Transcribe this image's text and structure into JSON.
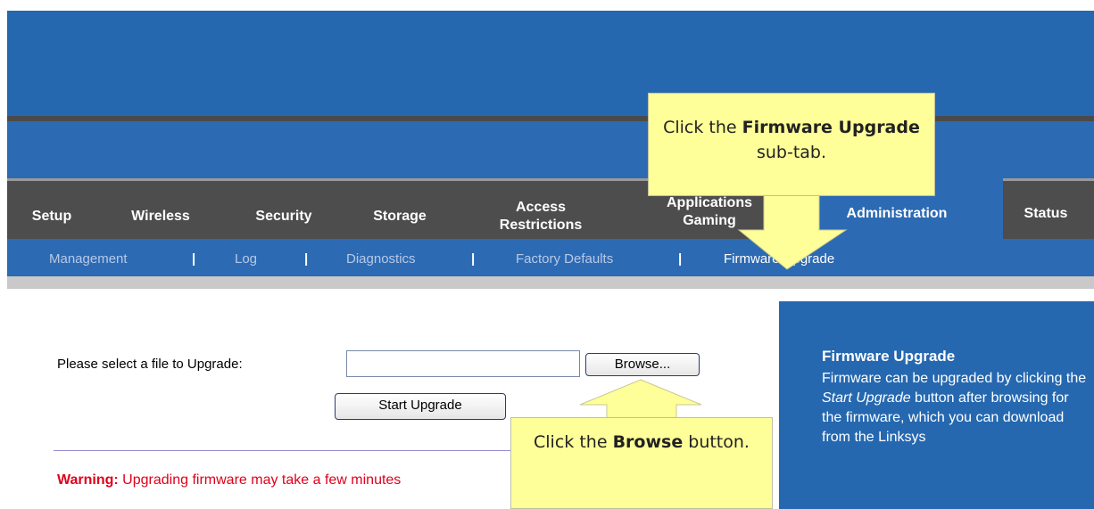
{
  "tabs": [
    {
      "label": "Setup"
    },
    {
      "label": "Wireless"
    },
    {
      "label": "Security"
    },
    {
      "label": "Storage"
    },
    {
      "label": "Access Restrictions"
    },
    {
      "label": "Applications Gaming"
    },
    {
      "label": "Administration",
      "active": true
    },
    {
      "label": "Status"
    }
  ],
  "subtabs": [
    {
      "label": "Management"
    },
    {
      "label": "Log"
    },
    {
      "label": "Diagnostics"
    },
    {
      "label": "Factory Defaults"
    },
    {
      "label": "Firmware Upgrade",
      "active": true
    }
  ],
  "separator": "|",
  "form": {
    "file_label": "Please select a file to Upgrade:",
    "file_value": "",
    "browse_label": "Browse...",
    "start_label": "Start Upgrade"
  },
  "warning": {
    "prefix": "Warning:",
    "text": " Upgrading firmware may take a few minutes"
  },
  "help": {
    "title": "Firmware Upgrade",
    "text_before": "Firmware can be upgraded by clicking the ",
    "text_em": "Start Upgrade",
    "text_after": " button after browsing for the firmware, which you can download from the Linksys"
  },
  "callouts": {
    "firmware": {
      "pre": "Click the ",
      "bold": "Firmware Upgrade",
      "post": " sub-tab."
    },
    "browse": {
      "pre": "Click the ",
      "bold": "Browse",
      "post": " button."
    }
  },
  "colors": {
    "banner": "#2568b0",
    "nav_dark": "#4d4d4d",
    "callout_yellow": "#ffff99",
    "warning_red": "#e0001a"
  }
}
